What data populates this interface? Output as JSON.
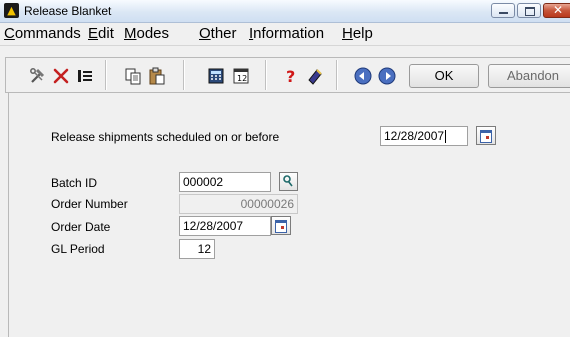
{
  "window": {
    "title": "Release Blanket",
    "icon": "app-logo-icon"
  },
  "menu": [
    {
      "label": "Commands",
      "mnemonic_index": 0
    },
    {
      "label": "Edit",
      "mnemonic_index": 0
    },
    {
      "label": "Modes",
      "mnemonic_index": 0
    },
    {
      "label": "Other",
      "mnemonic_index": 0
    },
    {
      "label": "Information",
      "mnemonic_index": 0
    },
    {
      "label": "Help",
      "mnemonic_index": 0
    }
  ],
  "toolbar": {
    "icons": [
      "wrench-hammer-icon",
      "delete-x-icon",
      "list-view-icon",
      "copy-icon",
      "paste-icon",
      "calculator-icon",
      "calendar-icon",
      "help-question-icon",
      "notes-pencil-icon",
      "globe-back-icon",
      "globe-forward-icon"
    ],
    "ok_label": "OK",
    "abandon_label": "Abandon"
  },
  "form": {
    "release_label": "Release shipments scheduled on or before",
    "release_date": "12/28/2007",
    "batch_id_label": "Batch ID",
    "batch_id_value": "000002",
    "order_number_label": "Order Number",
    "order_number_value": "00000026",
    "order_date_label": "Order Date",
    "order_date_value": "12/28/2007",
    "gl_period_label": "GL Period",
    "gl_period_value": "12"
  },
  "colors": {
    "titlebar_top": "#f7fbff",
    "titlebar_bottom": "#cfdff2",
    "close_button": "#c6563b",
    "window_bg": "#f0f0f0"
  }
}
